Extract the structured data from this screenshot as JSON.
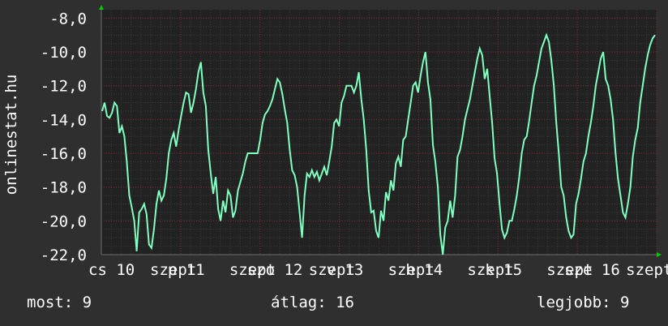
{
  "chart_data": {
    "type": "line",
    "ylabel": "onlinestat.hu",
    "ylim": [
      -22.0,
      -7.5
    ],
    "y_ticks": [
      "-8,0",
      "-10,0",
      "-12,0",
      "-14,0",
      "-16,0",
      "-18,0",
      "-20,0",
      "-22,0"
    ],
    "y_tick_values": [
      -8,
      -10,
      -12,
      -14,
      -16,
      -18,
      -20,
      -22
    ],
    "x_tick_labels": [
      "cs 10",
      "szept",
      "p 11",
      "szept",
      "szo 12",
      "szept",
      "v 13",
      "szept",
      "h 14",
      "szept",
      "k 15",
      "szept",
      "sze 16",
      "szept"
    ],
    "x_day_labels": [
      "cs 10",
      "p 11",
      "szo 12",
      "v 13",
      "h 14",
      "k 15",
      "sze 16"
    ],
    "x_month_label": "szept",
    "grid": true,
    "colors": {
      "background": "#2f2f2f",
      "plot_background": "#222222",
      "grid_minor": "#3a3a3a",
      "grid_major": "#7a2d2d",
      "axis": "#6e6e6e",
      "line": "#7fffc0",
      "text": "#ffffff",
      "arrow": "#00cc00"
    },
    "series": [
      {
        "values": [
          -13.5,
          -13.0,
          -13.8,
          -13.9,
          -13.6,
          -13.0,
          -13.2,
          -14.8,
          -14.4,
          -15.0,
          -16.5,
          -18.5,
          -19.2,
          -20.0,
          -21.8,
          -19.5,
          -19.3,
          -19.0,
          -19.6,
          -21.4,
          -21.6,
          -20.5,
          -19.0,
          -18.2,
          -18.8,
          -18.5,
          -17.5,
          -16.0,
          -15.2,
          -14.8,
          -15.6,
          -14.6,
          -13.8,
          -13.0,
          -12.4,
          -12.5,
          -13.6,
          -13.0,
          -12.2,
          -11.2,
          -10.6,
          -12.4,
          -13.2,
          -15.8,
          -17.2,
          -18.4,
          -17.4,
          -19.3,
          -20.0,
          -18.8,
          -19.5,
          -18.2,
          -18.5,
          -19.8,
          -19.4,
          -18.2,
          -17.7,
          -17.2,
          -16.5,
          -16.0,
          -16.0,
          -16.0,
          -16.0,
          -16.0,
          -15.2,
          -14.2,
          -13.7,
          -13.5,
          -13.2,
          -12.8,
          -12.2,
          -11.6,
          -11.8,
          -12.5,
          -13.4,
          -14.2,
          -15.8,
          -17.0,
          -17.3,
          -18.0,
          -19.5,
          -21.0,
          -18.5,
          -17.2,
          -17.4,
          -17.0,
          -17.4,
          -17.1,
          -17.6,
          -17.2,
          -16.8,
          -17.3,
          -16.5,
          -15.6,
          -14.2,
          -14.0,
          -14.4,
          -13.0,
          -12.6,
          -12.0,
          -12.0,
          -12.0,
          -12.4,
          -12.0,
          -11.2,
          -12.8,
          -14.0,
          -15.8,
          -18.2,
          -19.5,
          -19.4,
          -20.6,
          -21.0,
          -19.4,
          -20.0,
          -18.3,
          -18.8,
          -17.6,
          -18.2,
          -16.6,
          -16.2,
          -16.8,
          -15.2,
          -15.0,
          -14.0,
          -13.0,
          -12.0,
          -11.8,
          -12.4,
          -11.4,
          -10.6,
          -10.0,
          -11.8,
          -12.8,
          -15.5,
          -16.5,
          -18.0,
          -20.8,
          -22.0,
          -20.4,
          -20.0,
          -18.8,
          -19.8,
          -18.5,
          -16.2,
          -15.8,
          -15.0,
          -14.0,
          -13.4,
          -12.8,
          -12.0,
          -11.2,
          -10.4,
          -9.8,
          -10.2,
          -11.6,
          -11.0,
          -12.6,
          -14.2,
          -16.3,
          -17.2,
          -19.0,
          -20.5,
          -21.0,
          -20.7,
          -20.0,
          -20.0,
          -19.3,
          -18.5,
          -17.4,
          -16.0,
          -15.2,
          -15.0,
          -14.1,
          -13.0,
          -12.0,
          -11.4,
          -10.6,
          -9.8,
          -9.4,
          -9.0,
          -9.4,
          -10.5,
          -12.0,
          -14.2,
          -16.0,
          -18.0,
          -18.5,
          -19.8,
          -20.6,
          -21.0,
          -20.8,
          -19.0,
          -18.4,
          -17.5,
          -16.5,
          -16.0,
          -15.0,
          -14.2,
          -13.2,
          -12.0,
          -11.2,
          -10.4,
          -10.0,
          -11.6,
          -12.0,
          -12.8,
          -14.0,
          -16.0,
          -17.5,
          -18.5,
          -19.5,
          -19.8,
          -19.0,
          -18.0,
          -16.2,
          -15.2,
          -14.5,
          -13.0,
          -12.0,
          -11.0,
          -10.2,
          -9.6,
          -9.2,
          -9.0
        ]
      }
    ]
  },
  "stats": {
    "now_label": "most:",
    "now_value": "9",
    "avg_label": "átlag:",
    "avg_value": "16",
    "best_label": "legjobb:",
    "best_value": "9"
  }
}
